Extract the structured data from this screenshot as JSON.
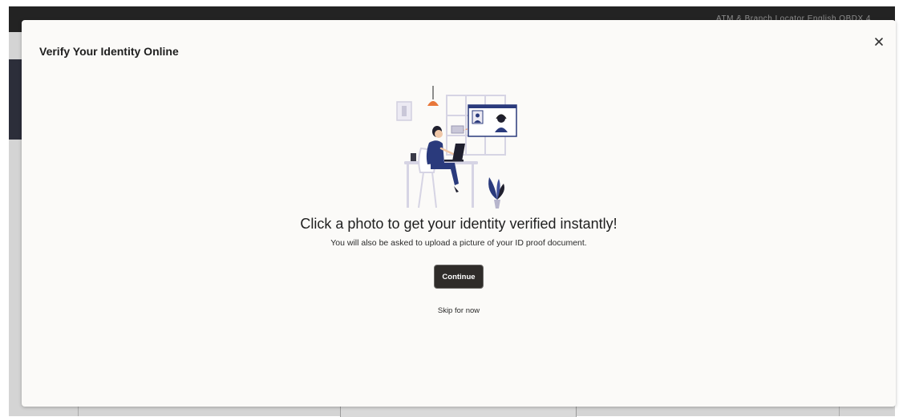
{
  "background": {
    "header_meta": "ATM & Branch Locator     English     OBDX 4"
  },
  "modal": {
    "title": "Verify Your Identity Online",
    "headline": "Click a photo to get your identity verified instantly!",
    "subtext": "You will also be asked to upload a picture of your ID proof document.",
    "continue_label": "Continue",
    "skip_label": "Skip for now",
    "close_icon": "close-icon",
    "illustration": "video-kyc-illustration"
  },
  "colors": {
    "modal_bg": "#fbfaf8",
    "primary_button": "#2f2c2a",
    "accent_orange": "#e8773a",
    "accent_navy": "#2a3a7c",
    "accent_lavender": "#d8d6e8"
  }
}
